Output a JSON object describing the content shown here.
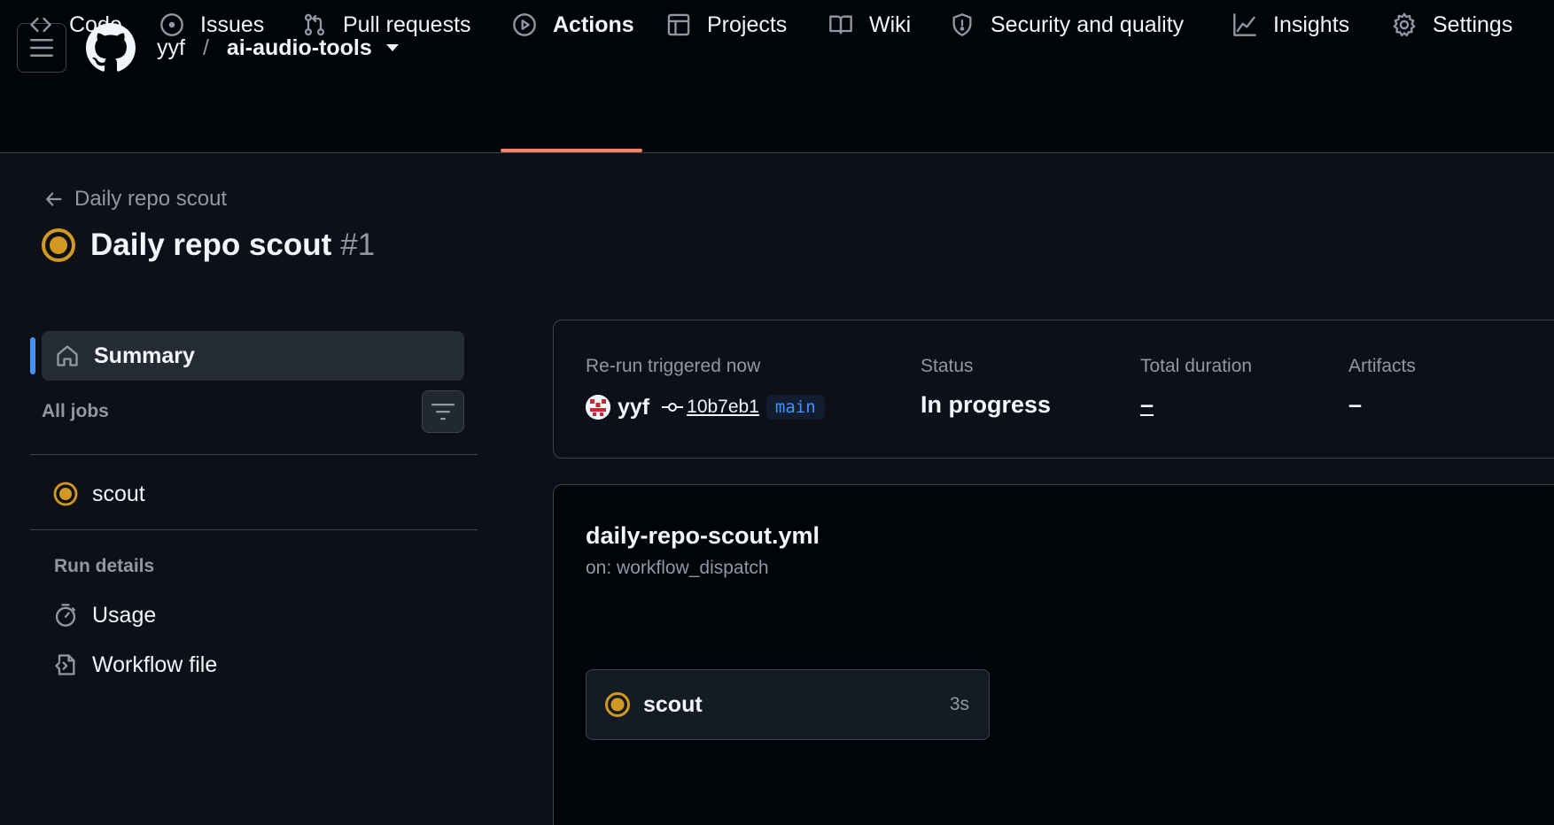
{
  "repo": {
    "owner": "yyf",
    "separator": "/",
    "name": "ai-audio-tools"
  },
  "tabs": [
    {
      "label": "Code",
      "icon": "code-icon"
    },
    {
      "label": "Issues",
      "icon": "issue-icon"
    },
    {
      "label": "Pull requests",
      "icon": "pull-request-icon"
    },
    {
      "label": "Actions",
      "icon": "play-icon",
      "active": true
    },
    {
      "label": "Projects",
      "icon": "table-icon"
    },
    {
      "label": "Wiki",
      "icon": "book-icon"
    },
    {
      "label": "Security and quality",
      "icon": "shield-icon"
    },
    {
      "label": "Insights",
      "icon": "graph-icon"
    },
    {
      "label": "Settings",
      "icon": "gear-icon"
    }
  ],
  "back_link": "Daily repo scout",
  "title": {
    "name": "Daily repo scout",
    "run_number": "#1"
  },
  "sidebar": {
    "summary": "Summary",
    "all_jobs": "All jobs",
    "jobs": [
      {
        "name": "scout",
        "status": "in-progress"
      }
    ],
    "run_details_label": "Run details",
    "details": [
      {
        "label": "Usage",
        "icon": "stopwatch-icon"
      },
      {
        "label": "Workflow file",
        "icon": "file-code-icon"
      }
    ]
  },
  "summary_card": {
    "trigger_label": "Re-run triggered now",
    "user": "yyf",
    "commit": "10b7eb1",
    "branch": "main",
    "status_label": "Status",
    "status_value": "In progress",
    "duration_label": "Total duration",
    "duration_value": "–",
    "artifacts_label": "Artifacts",
    "artifacts_value": "–"
  },
  "workflow": {
    "file": "daily-repo-scout.yml",
    "trigger": "on: workflow_dispatch",
    "job": {
      "name": "scout",
      "duration": "3s"
    }
  },
  "colors": {
    "accent_underline": "#f78166",
    "in_progress": "#d29922",
    "link_blue": "#4493f8"
  }
}
